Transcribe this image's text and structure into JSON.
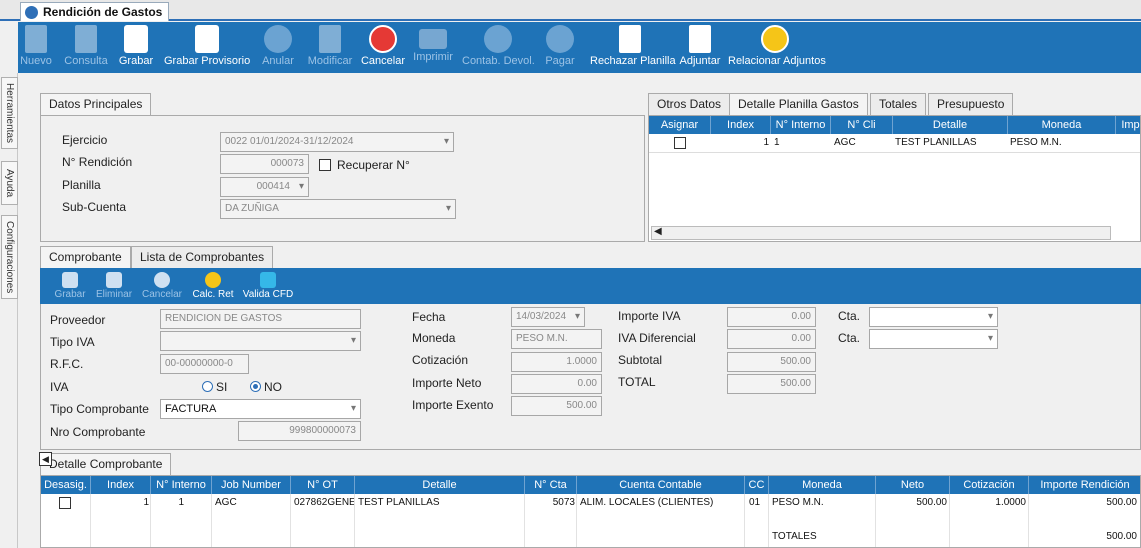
{
  "window": {
    "title": "Rendición de Gastos"
  },
  "toolbar": [
    {
      "label": "Nuevo",
      "icon": "new-doc-icon",
      "enabled": false
    },
    {
      "label": "Consulta",
      "icon": "query-doc-icon",
      "enabled": false
    },
    {
      "label": "Grabar",
      "icon": "save-icon",
      "enabled": true
    },
    {
      "label": "Grabar Provisorio",
      "icon": "save-draft-icon",
      "enabled": true
    },
    {
      "label": "Anular",
      "icon": "void-icon",
      "enabled": false
    },
    {
      "label": "Modificar",
      "icon": "edit-icon",
      "enabled": false
    },
    {
      "label": "Cancelar",
      "icon": "cancel-icon",
      "enabled": true
    },
    {
      "label": "Imprimir",
      "icon": "printer-icon",
      "enabled": false
    },
    {
      "label": "Contab. Devol.",
      "icon": "accounting-icon",
      "enabled": false
    },
    {
      "label": "Pagar",
      "icon": "pay-icon",
      "enabled": false
    },
    {
      "label": "Rechazar Planilla",
      "icon": "reject-sheet-icon",
      "enabled": true
    },
    {
      "label": "Adjuntar",
      "icon": "attach-icon",
      "enabled": true
    },
    {
      "label": "Relacionar Adjuntos",
      "icon": "link-attachments-icon",
      "enabled": true
    }
  ],
  "sidebar": {
    "tabs": [
      "Herramientas",
      "Ayuda",
      "Configuraciones"
    ]
  },
  "datos": {
    "tab": "Datos Principales",
    "ejercicio_label": "Ejercicio",
    "ejercicio_value": "0022 01/01/2024-31/12/2024",
    "rendicion_label": "N° Rendición",
    "rendicion_value": "000073",
    "recuperar_label": "Recuperar N°",
    "planilla_label": "Planilla",
    "planilla_value": "000414",
    "subcuenta_label": "Sub-Cuenta",
    "subcuenta_value": "DA    ZUÑIGA"
  },
  "right": {
    "tabs": [
      "Otros Datos",
      "Detalle Planilla Gastos",
      "Totales",
      "Presupuesto"
    ],
    "headers": [
      "Asignar",
      "Index",
      "N° Interno",
      "N° Cli",
      "Detalle",
      "Moneda",
      "Imp"
    ],
    "rows": [
      {
        "index": "1",
        "interno": "1",
        "cli": "AGC",
        "detalle": "TEST PLANILLAS",
        "moneda": "PESO M.N."
      }
    ]
  },
  "comprobante": {
    "tabs": [
      "Comprobante",
      "Lista de Comprobantes"
    ],
    "toolbar": [
      {
        "label": "Grabar",
        "enabled": false
      },
      {
        "label": "Eliminar",
        "enabled": false
      },
      {
        "label": "Cancelar",
        "enabled": false
      },
      {
        "label": "Calc. Ret",
        "enabled": true
      },
      {
        "label": "Valida CFD",
        "enabled": true
      }
    ],
    "proveedor_label": "Proveedor",
    "proveedor_value": "RENDICION DE GASTOS",
    "tipoiva_label": "Tipo IVA",
    "tipoiva_value": "",
    "rfc_label": "R.F.C.",
    "rfc_value": "00-00000000-0",
    "iva_label": "IVA",
    "iva_si": "SI",
    "iva_no": "NO",
    "tipocomp_label": "Tipo Comprobante",
    "tipocomp_value": "FACTURA",
    "nrocomp_label": "Nro Comprobante",
    "nrocomp_value": "999800000073",
    "fecha_label": "Fecha",
    "fecha_value": "14/03/2024",
    "moneda_label": "Moneda",
    "moneda_value": "PESO M.N.",
    "cotizacion_label": "Cotización",
    "cotizacion_value": "1.0000",
    "impneto_label": "Importe Neto",
    "impneto_value": "0.00",
    "impexento_label": "Importe Exento",
    "impexento_value": "500.00",
    "impiva_label": "Importe IVA",
    "impiva_value": "0.00",
    "ivadif_label": "IVA Diferencial",
    "ivadif_value": "0.00",
    "subtotal_label": "Subtotal",
    "subtotal_value": "500.00",
    "total_label": "TOTAL",
    "total_value": "500.00",
    "cta_label": "Cta."
  },
  "detalle": {
    "tab": "Detalle Comprobante",
    "headers": [
      "Desasig.",
      "Index",
      "N° Interno",
      "Job Number",
      "N° OT",
      "Detalle",
      "N° Cta",
      "Cuenta Contable",
      "CC",
      "Moneda",
      "Neto",
      "Cotización",
      "Importe Rendición"
    ],
    "row": {
      "index": "1",
      "interno": "1",
      "job": "AGC",
      "ot": "027862GENE",
      "detalle": "TEST PLANILLAS",
      "cta": "5073",
      "cuenta": "ALIM. LOCALES (CLIENTES)",
      "cc": "01",
      "moneda": "PESO M.N.",
      "neto": "500.00",
      "cotizacion": "1.0000",
      "importe": "500.00"
    },
    "totales_label": "TOTALES",
    "totales_value": "500.00"
  },
  "colors": {
    "accent": "#1f73b7",
    "cancel": "#e53935"
  }
}
